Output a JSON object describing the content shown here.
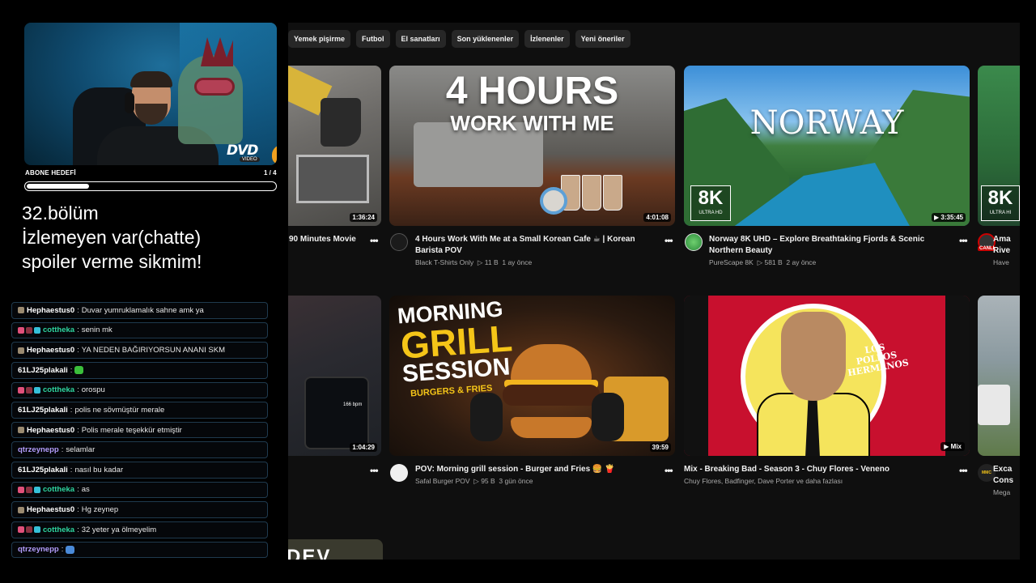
{
  "stream": {
    "goal_label": "ABONE HEDEFİ",
    "goal_count": "1 / 4",
    "goal_progress": 0.25,
    "webcam_logo": "DVD",
    "webcam_logo_sub": "VIDEO",
    "note_lines": [
      "32.bölüm",
      "İzlemeyen var(chatte)",
      "spoiler verme sikmim!"
    ]
  },
  "chat": [
    {
      "user": "Hephaestus0",
      "color": "#ffffff",
      "badges": [
        "#9a8a70"
      ],
      "text": "Duvar yumruklamalık sahne amk ya"
    },
    {
      "user": "cottheka",
      "color": "#2fd6a0",
      "badges": [
        "#e0507a",
        "#8a3040",
        "#35c0d8"
      ],
      "text": "senin mk"
    },
    {
      "user": "Hephaestus0",
      "color": "#ffffff",
      "badges": [
        "#9a8a70"
      ],
      "text": "YA NEDEN BAĞIRIYORSUN ANANI SKM"
    },
    {
      "user": "61LJ25plakali",
      "color": "#ffffff",
      "badges": [],
      "text": "",
      "emote": "#3bbf3b"
    },
    {
      "user": "cottheka",
      "color": "#2fd6a0",
      "badges": [
        "#e0507a",
        "#8a3040",
        "#35c0d8"
      ],
      "text": "orospu"
    },
    {
      "user": "61LJ25plakali",
      "color": "#ffffff",
      "badges": [],
      "text": "polis ne sövmüştür merale"
    },
    {
      "user": "Hephaestus0",
      "color": "#ffffff",
      "badges": [
        "#9a8a70"
      ],
      "text": "Polis merale teşekkür etmiştir"
    },
    {
      "user": "qtrzeynepp",
      "color": "#b39dfb",
      "badges": [],
      "text": "selamlar"
    },
    {
      "user": "61LJ25plakali",
      "color": "#ffffff",
      "badges": [],
      "text": "nasıl bu kadar"
    },
    {
      "user": "cottheka",
      "color": "#2fd6a0",
      "badges": [
        "#e0507a",
        "#8a3040",
        "#35c0d8"
      ],
      "text": "as"
    },
    {
      "user": "Hephaestus0",
      "color": "#ffffff",
      "badges": [
        "#9a8a70"
      ],
      "text": "Hg zeynep"
    },
    {
      "user": "cottheka",
      "color": "#2fd6a0",
      "badges": [
        "#e0507a",
        "#8a3040",
        "#35c0d8"
      ],
      "text": "32 yeter ya ölmeyelim"
    },
    {
      "user": "qtrzeynepp",
      "color": "#b39dfb",
      "badges": [],
      "text": "",
      "emote": "#4a8ad8"
    }
  ],
  "youtube": {
    "chips": [
      "Yemek pişirme",
      "Futbol",
      "El sanatları",
      "Son yüklenenler",
      "İzlenenler",
      "Yeni öneriler"
    ],
    "kebab": "•••",
    "row1": {
      "partial_left": {
        "title": "90 Minutes Movie",
        "duration": "1:36:24"
      },
      "video1": {
        "title": "4 Hours Work With Me at a Small Korean Cafe ☕ | Korean Barista POV",
        "channel": "Black T-Shirts Only",
        "views": "▷ 11 B",
        "age": "1 ay önce",
        "duration": "4:01:08",
        "thumb_line1": "4 HOURS",
        "thumb_line2": "WORK WITH ME"
      },
      "video2": {
        "title": "Norway 8K UHD – Explore Breathtaking Fjords & Scenic Northern Beauty",
        "channel": "PureScape 8K",
        "views": "▷ 581 B",
        "age": "2 ay önce",
        "duration": "▶ 3:35:45",
        "thumb_text": "NORWAY",
        "badge_big": "8K",
        "badge_small": "ULTRA HD"
      },
      "partial_right": {
        "title_line1": "Ama",
        "title_line2": "Rive",
        "meta": "Have",
        "badge_big": "8K",
        "badge_small": "ULTRA HI",
        "live": "CANLI"
      }
    },
    "row2": {
      "partial_left": {
        "duration": "1:04:29",
        "bpm": "166 bpm"
      },
      "video1": {
        "title": "POV: Morning grill session - Burger and Fries 🍔 🍟",
        "channel": "Safal Burger POV",
        "views": "▷ 95 B",
        "age": "3 gün önce",
        "duration": "39:59",
        "thumb_line1": "MORNING",
        "thumb_line2": "GRILL",
        "thumb_line3": "SESSION",
        "thumb_line4": "BURGERS & FRIES"
      },
      "video2": {
        "title": "Mix - Breaking Bad - Season 3 - Chuy Flores - Veneno",
        "channel": "Chuy Flores, Badfinger, Dave Porter ve daha fazlası",
        "badge": "▶ Mix",
        "thumb_line1": "LOS",
        "thumb_line2": "POLLOS",
        "thumb_line3": "HERMANOS"
      },
      "partial_right": {
        "title_line1": "Exca",
        "title_line2": "Cons",
        "meta": "Mega",
        "avatar_text": "MMC"
      }
    },
    "row3": {
      "partial_left_text": "DEV EDIT"
    }
  }
}
